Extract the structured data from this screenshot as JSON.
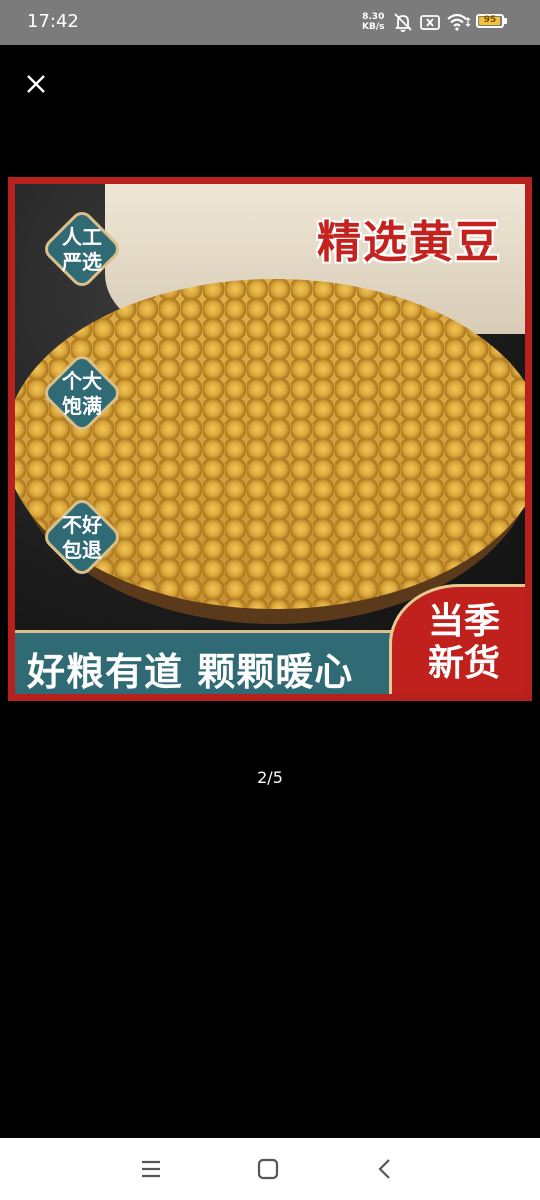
{
  "status_bar": {
    "time": "17:42",
    "net_speed_value": "8.30",
    "net_speed_unit": "KB/s",
    "battery_level": "95",
    "battery_color": "#f2c23a",
    "icons": [
      "mute-icon",
      "sim-off-icon",
      "wifi-icon",
      "battery-icon"
    ]
  },
  "viewer": {
    "close_icon": "close-icon",
    "pager": "2/5"
  },
  "product_image": {
    "title": "精选黄豆",
    "badges": [
      {
        "line1": "人工",
        "line2": "严选"
      },
      {
        "line1": "个大",
        "line2": "饱满"
      },
      {
        "line1": "不好",
        "line2": "包退"
      }
    ],
    "slogan": "好粮有道 颗颗暖心",
    "season_line1": "当季",
    "season_line2": "新货",
    "colors": {
      "frame": "#b8201e",
      "banner": "#2f6a75",
      "badge": "#2f6a75",
      "gold": "#d9bf88"
    }
  },
  "nav_bar": {
    "icons": [
      "menu-icon",
      "home-icon",
      "back-icon"
    ]
  }
}
